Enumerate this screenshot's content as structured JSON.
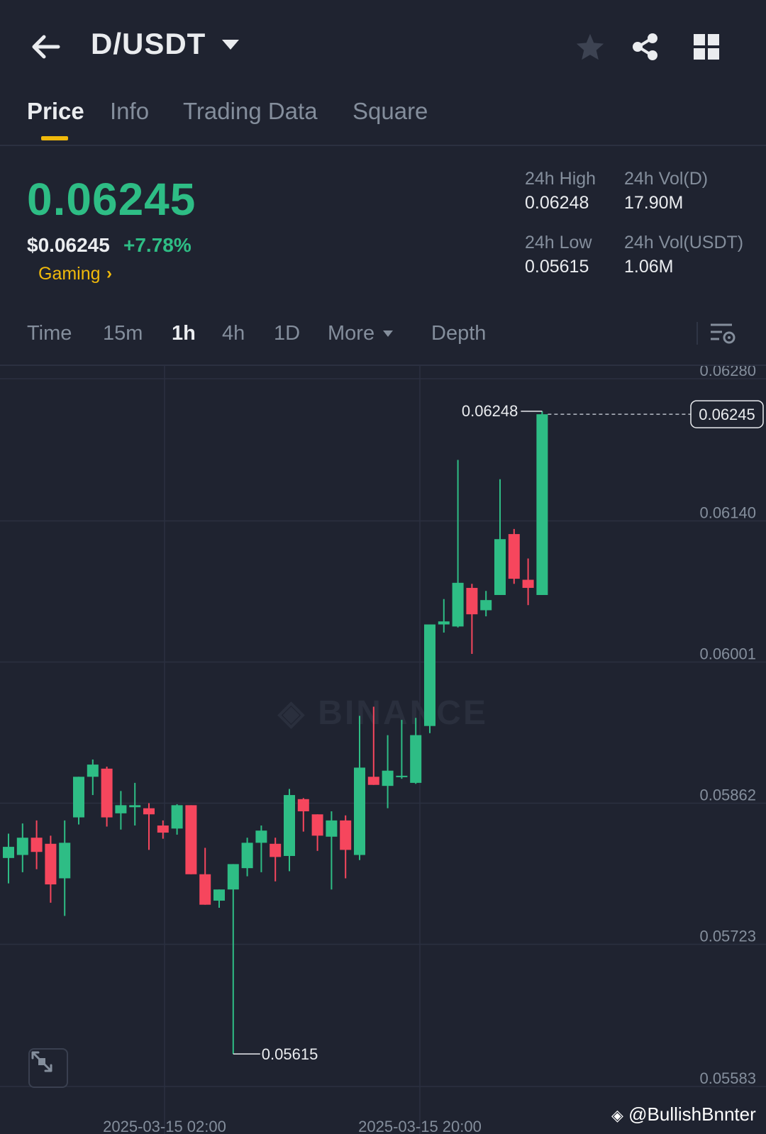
{
  "header": {
    "pair": "D/USDT",
    "icons": [
      "back-arrow-icon",
      "caret-down-icon",
      "star-icon",
      "share-icon",
      "grid-icon"
    ]
  },
  "tabs": [
    {
      "label": "Price",
      "active": true
    },
    {
      "label": "Info",
      "active": false
    },
    {
      "label": "Trading Data",
      "active": false
    },
    {
      "label": "Square",
      "active": false
    }
  ],
  "ticker": {
    "last_price": "0.06245",
    "usd_price": "$0.06245",
    "change": "+7.78%",
    "category": "Gaming",
    "category_chevron": "›",
    "high_label": "24h High",
    "high_value": "0.06248",
    "low_label": "24h Low",
    "low_value": "0.05615",
    "vol_base_label": "24h Vol(D)",
    "vol_base_value": "17.90M",
    "vol_quote_label": "24h Vol(USDT)",
    "vol_quote_value": "1.06M"
  },
  "intervals": [
    {
      "label": "Time",
      "active": false
    },
    {
      "label": "15m",
      "active": false
    },
    {
      "label": "1h",
      "active": true
    },
    {
      "label": "4h",
      "active": false
    },
    {
      "label": "1D",
      "active": false
    },
    {
      "label": "More",
      "active": false
    },
    {
      "label": "Depth",
      "active": false
    }
  ],
  "colors": {
    "up": "#2ebd85",
    "down": "#f6465d",
    "accent": "#f0b90b",
    "background": "#1f2330"
  },
  "watermark": {
    "brand": "BINANCE",
    "user": "@BullishBnnter"
  },
  "chart_data": {
    "type": "candlestick",
    "interval": "1h",
    "y_ticks": [
      "0.06280",
      "0.06140",
      "0.06001",
      "0.05862",
      "0.05723",
      "0.05583"
    ],
    "x_ticks": [
      "2025-03-15 02:00",
      "2025-03-15 20:00"
    ],
    "ylim": [
      0.05583,
      0.0628
    ],
    "current_price_label": "0.06245",
    "high_marker": "0.06248",
    "low_marker": "0.05615",
    "candles": [
      {
        "o": 0.05808,
        "h": 0.05832,
        "l": 0.05783,
        "c": 0.05819
      },
      {
        "o": 0.05811,
        "h": 0.05842,
        "l": 0.05794,
        "c": 0.05828
      },
      {
        "o": 0.05828,
        "h": 0.05845,
        "l": 0.05797,
        "c": 0.05814
      },
      {
        "o": 0.05822,
        "h": 0.0583,
        "l": 0.05764,
        "c": 0.05782
      },
      {
        "o": 0.05788,
        "h": 0.05845,
        "l": 0.05751,
        "c": 0.05823
      },
      {
        "o": 0.05848,
        "h": 0.05887,
        "l": 0.05841,
        "c": 0.05888
      },
      {
        "o": 0.05888,
        "h": 0.05905,
        "l": 0.0587,
        "c": 0.059
      },
      {
        "o": 0.05896,
        "h": 0.05898,
        "l": 0.05839,
        "c": 0.05848
      },
      {
        "o": 0.05852,
        "h": 0.05874,
        "l": 0.05836,
        "c": 0.0586
      },
      {
        "o": 0.05858,
        "h": 0.05882,
        "l": 0.0584,
        "c": 0.0586
      },
      {
        "o": 0.05857,
        "h": 0.05862,
        "l": 0.05816,
        "c": 0.05851
      },
      {
        "o": 0.0584,
        "h": 0.05845,
        "l": 0.05827,
        "c": 0.05833
      },
      {
        "o": 0.05837,
        "h": 0.05861,
        "l": 0.05831,
        "c": 0.0586
      },
      {
        "o": 0.0586,
        "h": 0.0586,
        "l": 0.05793,
        "c": 0.05792
      },
      {
        "o": 0.05792,
        "h": 0.05818,
        "l": 0.05762,
        "c": 0.05762
      },
      {
        "o": 0.05766,
        "h": 0.05777,
        "l": 0.05759,
        "c": 0.05777
      },
      {
        "o": 0.05777,
        "h": 0.05801,
        "l": 0.05615,
        "c": 0.05802
      },
      {
        "o": 0.05798,
        "h": 0.05828,
        "l": 0.0579,
        "c": 0.05823
      },
      {
        "o": 0.05823,
        "h": 0.0584,
        "l": 0.05794,
        "c": 0.05835
      },
      {
        "o": 0.05822,
        "h": 0.05828,
        "l": 0.05785,
        "c": 0.05809
      },
      {
        "o": 0.0581,
        "h": 0.05876,
        "l": 0.05795,
        "c": 0.0587
      },
      {
        "o": 0.05866,
        "h": 0.05867,
        "l": 0.05834,
        "c": 0.05854
      },
      {
        "o": 0.05851,
        "h": 0.05847,
        "l": 0.05815,
        "c": 0.0583
      },
      {
        "o": 0.05829,
        "h": 0.05854,
        "l": 0.05777,
        "c": 0.05845
      },
      {
        "o": 0.05845,
        "h": 0.0585,
        "l": 0.05788,
        "c": 0.05816
      },
      {
        "o": 0.05811,
        "h": 0.05948,
        "l": 0.05806,
        "c": 0.05897
      },
      {
        "o": 0.05888,
        "h": 0.05957,
        "l": 0.05881,
        "c": 0.0588
      },
      {
        "o": 0.05879,
        "h": 0.05929,
        "l": 0.05857,
        "c": 0.05894
      },
      {
        "o": 0.05889,
        "h": 0.05944,
        "l": 0.05886,
        "c": 0.05889
      },
      {
        "o": 0.05882,
        "h": 0.05946,
        "l": 0.05881,
        "c": 0.05929
      },
      {
        "o": 0.05938,
        "h": 0.06033,
        "l": 0.05931,
        "c": 0.06038
      },
      {
        "o": 0.06038,
        "h": 0.06063,
        "l": 0.0603,
        "c": 0.06041
      },
      {
        "o": 0.06036,
        "h": 0.062,
        "l": 0.06035,
        "c": 0.06079
      },
      {
        "o": 0.06074,
        "h": 0.06078,
        "l": 0.06009,
        "c": 0.06048
      },
      {
        "o": 0.06052,
        "h": 0.06071,
        "l": 0.06046,
        "c": 0.06062
      },
      {
        "o": 0.06067,
        "h": 0.06181,
        "l": 0.0607,
        "c": 0.06122
      },
      {
        "o": 0.06127,
        "h": 0.06132,
        "l": 0.06078,
        "c": 0.06083
      },
      {
        "o": 0.06082,
        "h": 0.06103,
        "l": 0.06057,
        "c": 0.06074
      },
      {
        "o": 0.06067,
        "h": 0.06248,
        "l": 0.06069,
        "c": 0.06245
      }
    ]
  }
}
